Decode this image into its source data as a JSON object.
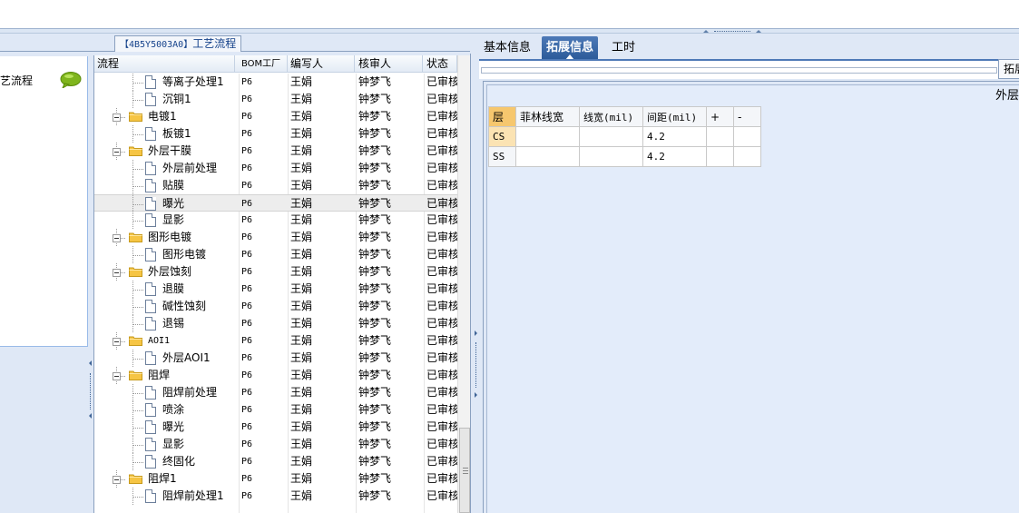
{
  "left_panel": {
    "title_code": "【4B5Y5003A0】",
    "title_text": "工艺流程"
  },
  "nav": {
    "item_label": "工艺流程"
  },
  "grid": {
    "columns": [
      "流程",
      "BOM工厂",
      "编写人",
      "核审人",
      "状态"
    ],
    "rows": [
      {
        "level": 2,
        "label": "等离子处理1",
        "bom": "P6",
        "writer": "王娟",
        "reviewer": "钟梦飞",
        "status": "已审核"
      },
      {
        "level": 2,
        "label": "沉铜1",
        "bom": "P6",
        "writer": "王娟",
        "reviewer": "钟梦飞",
        "status": "已审核"
      },
      {
        "level": 1,
        "label": "电镀1",
        "bom": "P6",
        "writer": "王娟",
        "reviewer": "钟梦飞",
        "status": "已审核"
      },
      {
        "level": 2,
        "label": "板镀1",
        "bom": "P6",
        "writer": "王娟",
        "reviewer": "钟梦飞",
        "status": "已审核"
      },
      {
        "level": 1,
        "label": "外层干膜",
        "bom": "P6",
        "writer": "王娟",
        "reviewer": "钟梦飞",
        "status": "已审核"
      },
      {
        "level": 2,
        "label": "外层前处理",
        "bom": "P6",
        "writer": "王娟",
        "reviewer": "钟梦飞",
        "status": "已审核"
      },
      {
        "level": 2,
        "label": "贴膜",
        "bom": "P6",
        "writer": "王娟",
        "reviewer": "钟梦飞",
        "status": "已审核"
      },
      {
        "level": 2,
        "label": "曝光",
        "bom": "P6",
        "writer": "王娟",
        "reviewer": "钟梦飞",
        "status": "已审核",
        "selected": true
      },
      {
        "level": 2,
        "label": "显影",
        "bom": "P6",
        "writer": "王娟",
        "reviewer": "钟梦飞",
        "status": "已审核"
      },
      {
        "level": 1,
        "label": "图形电镀",
        "bom": "P6",
        "writer": "王娟",
        "reviewer": "钟梦飞",
        "status": "已审核"
      },
      {
        "level": 2,
        "label": "图形电镀",
        "bom": "P6",
        "writer": "王娟",
        "reviewer": "钟梦飞",
        "status": "已审核"
      },
      {
        "level": 1,
        "label": "外层蚀刻",
        "bom": "P6",
        "writer": "王娟",
        "reviewer": "钟梦飞",
        "status": "已审核"
      },
      {
        "level": 2,
        "label": "退膜",
        "bom": "P6",
        "writer": "王娟",
        "reviewer": "钟梦飞",
        "status": "已审核"
      },
      {
        "level": 2,
        "label": "碱性蚀刻",
        "bom": "P6",
        "writer": "王娟",
        "reviewer": "钟梦飞",
        "status": "已审核"
      },
      {
        "level": 2,
        "label": "退锡",
        "bom": "P6",
        "writer": "王娟",
        "reviewer": "钟梦飞",
        "status": "已审核"
      },
      {
        "level": 1,
        "label": "AOI1",
        "bom": "P6",
        "writer": "王娟",
        "reviewer": "钟梦飞",
        "status": "已审核"
      },
      {
        "level": 2,
        "label": "外层AOI1",
        "bom": "P6",
        "writer": "王娟",
        "reviewer": "钟梦飞",
        "status": "已审核"
      },
      {
        "level": 1,
        "label": "阻焊",
        "bom": "P6",
        "writer": "王娟",
        "reviewer": "钟梦飞",
        "status": "已审核"
      },
      {
        "level": 2,
        "label": "阻焊前处理",
        "bom": "P6",
        "writer": "王娟",
        "reviewer": "钟梦飞",
        "status": "已审核"
      },
      {
        "level": 2,
        "label": "喷涂",
        "bom": "P6",
        "writer": "王娟",
        "reviewer": "钟梦飞",
        "status": "已审核"
      },
      {
        "level": 2,
        "label": "曝光",
        "bom": "P6",
        "writer": "王娟",
        "reviewer": "钟梦飞",
        "status": "已审核"
      },
      {
        "level": 2,
        "label": "显影",
        "bom": "P6",
        "writer": "王娟",
        "reviewer": "钟梦飞",
        "status": "已审核"
      },
      {
        "level": 2,
        "label": "终固化",
        "bom": "P6",
        "writer": "王娟",
        "reviewer": "钟梦飞",
        "status": "已审核"
      },
      {
        "level": 1,
        "label": "阻焊1",
        "bom": "P6",
        "writer": "王娟",
        "reviewer": "钟梦飞",
        "status": "已审核"
      },
      {
        "level": 2,
        "label": "阻焊前处理1",
        "bom": "P6",
        "writer": "王娟",
        "reviewer": "钟梦飞",
        "status": "已审核"
      }
    ]
  },
  "right_panel": {
    "tabs": [
      {
        "label": "基本信息",
        "active": false
      },
      {
        "label": "拓展信息",
        "active": true
      },
      {
        "label": "工时",
        "active": false
      }
    ],
    "expand_button": "拓展",
    "outer_label": "外层干",
    "table": {
      "headers": [
        "层",
        "菲林线宽",
        "线宽(mil)",
        "间距(mil)",
        "+",
        "-"
      ],
      "rows": [
        [
          "CS",
          "",
          "",
          "4.2",
          "",
          ""
        ],
        [
          "SS",
          "",
          "",
          "4.2",
          "",
          ""
        ]
      ]
    }
  },
  "colors": {
    "panel_bg": "#dfe8f6",
    "tab_active": "#3a67a8",
    "header_layer": "#f6c76e",
    "title_text": "#15428b"
  }
}
